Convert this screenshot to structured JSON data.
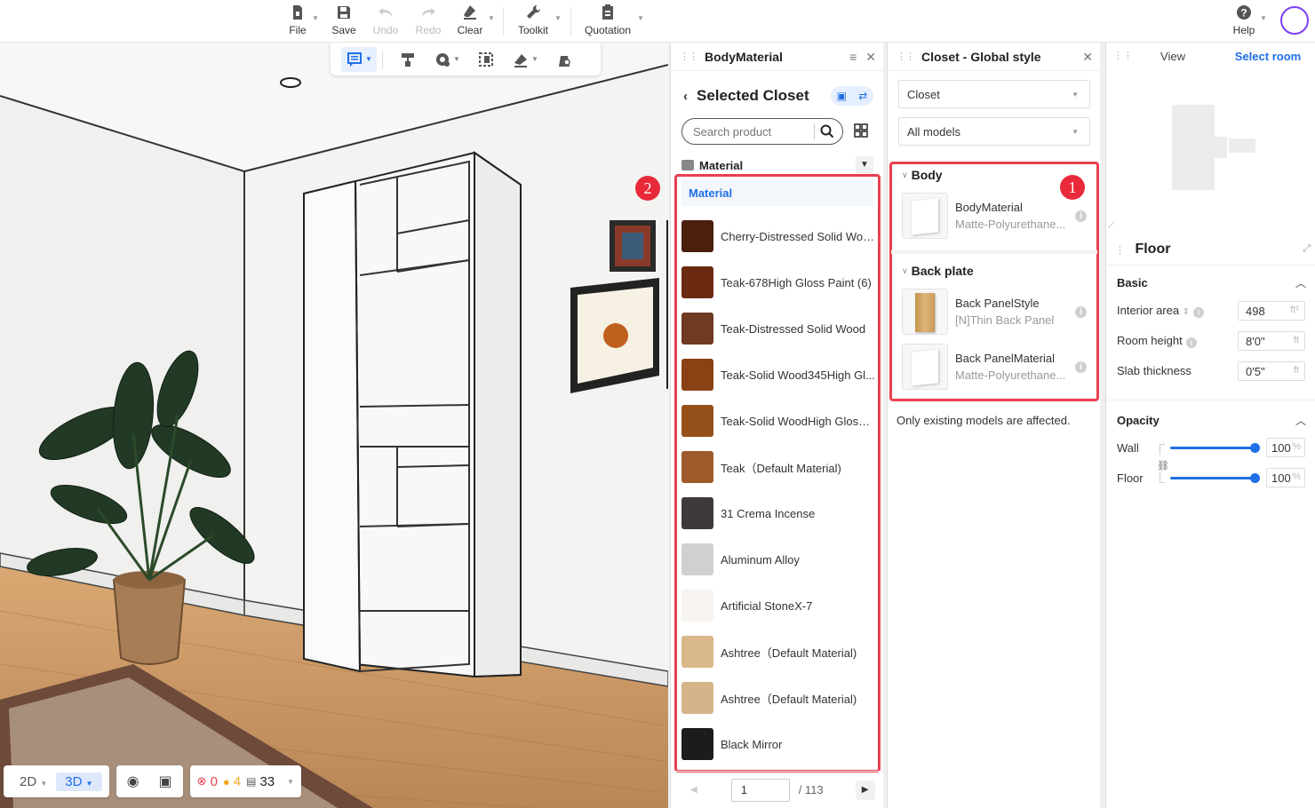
{
  "toolbar": {
    "file": "File",
    "save": "Save",
    "undo": "Undo",
    "redo": "Redo",
    "clear": "Clear",
    "toolkit": "Toolkit",
    "quotation": "Quotation",
    "help": "Help"
  },
  "viewport": {
    "view_2d": "2D",
    "view_3d": "3D",
    "errors": "0",
    "warnings": "4",
    "items": "33"
  },
  "material_panel": {
    "title": "BodyMaterial",
    "selected_title": "Selected Closet",
    "search_placeholder": "Search product",
    "category": "Material",
    "subcategory": "Material",
    "badge": "2",
    "items": [
      {
        "name": "Cherry-Distressed Solid Wood",
        "color": "#4a1f0e"
      },
      {
        "name": "Teak-678High Gloss Paint (6)",
        "color": "#6b2a10"
      },
      {
        "name": "Teak-Distressed Solid Wood",
        "color": "#6e3a22"
      },
      {
        "name": "Teak-Solid Wood345High Gl...",
        "color": "#8a4215"
      },
      {
        "name": "Teak-Solid WoodHigh Gloss ...",
        "color": "#955019"
      },
      {
        "name": "Teak（Default Material)",
        "color": "#9e5a2a"
      },
      {
        "name": "31 Crema Incense",
        "color": "#3f3a3a"
      },
      {
        "name": "Aluminum Alloy",
        "color": "#d0d0d0"
      },
      {
        "name": "Artificial StoneX-7",
        "color": "#f7f4ef"
      },
      {
        "name": "Ashtree（Default Material)",
        "color": "#d9b88c"
      },
      {
        "name": "Ashtree（Default Material)",
        "color": "#d6b48a"
      },
      {
        "name": "Black Mirror",
        "color": "#1c1c1c"
      }
    ],
    "page_current": "1",
    "page_total": "/ 113"
  },
  "closet_panel": {
    "title": "Closet - Global style",
    "select_type": "Closet",
    "select_models": "All models",
    "badge": "1",
    "body_group": "Body",
    "body_items": [
      {
        "name": "BodyMaterial",
        "sub": "Matte-Polyurethane..."
      }
    ],
    "back_group": "Back plate",
    "back_items": [
      {
        "name": "Back PanelStyle",
        "sub": "[N]Thin Back Panel"
      },
      {
        "name": "Back PanelMaterial",
        "sub": "Matte-Polyurethane..."
      }
    ],
    "note": "Only existing models are affected."
  },
  "right_panel": {
    "tab_view": "View",
    "tab_select_room": "Select room",
    "floor_title": "Floor",
    "basic_title": "Basic",
    "interior_area_label": "Interior area",
    "interior_area_value": "498",
    "interior_area_unit": "ft²",
    "room_height_label": "Room height",
    "room_height_value": "8'0\"",
    "room_height_unit": "ft",
    "slab_label": "Slab thickness",
    "slab_value": "0'5\"",
    "slab_unit": "ft",
    "opacity_title": "Opacity",
    "wall_label": "Wall",
    "wall_value": "100",
    "floor_label": "Floor",
    "floor_value": "100",
    "percent": "%"
  },
  "colors": {
    "accent": "#1f6fe5",
    "highlight_box": "#e8404f",
    "avatar_ring": "#7b3ff2"
  }
}
